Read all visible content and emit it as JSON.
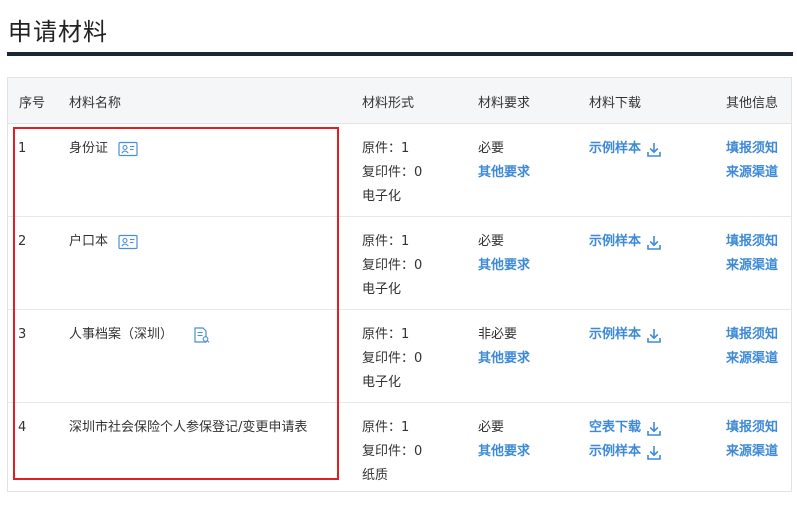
{
  "page_title": "申请材料",
  "table": {
    "headers": {
      "seq": "序号",
      "name": "材料名称",
      "form": "材料形式",
      "requirement": "材料要求",
      "download": "材料下载",
      "other": "其他信息"
    },
    "rows": [
      {
        "seq": "1",
        "name": "身份证",
        "name_icon": "id-card-icon",
        "form": [
          "原件：1",
          "复印件：0",
          "电子化"
        ],
        "requirement": "必要",
        "requirement_link": "其他要求",
        "downloads": [
          "示例样本"
        ],
        "other": [
          "填报须知",
          "来源渠道"
        ]
      },
      {
        "seq": "2",
        "name": "户口本",
        "name_icon": "id-card-icon",
        "form": [
          "原件：1",
          "复印件：0",
          "电子化"
        ],
        "requirement": "必要",
        "requirement_link": "其他要求",
        "downloads": [
          "示例样本"
        ],
        "other": [
          "填报须知",
          "来源渠道"
        ]
      },
      {
        "seq": "3",
        "name": "人事档案（深圳）",
        "name_icon": "document-icon",
        "form": [
          "原件：1",
          "复印件：0",
          "电子化"
        ],
        "requirement": "非必要",
        "requirement_link": "其他要求",
        "downloads": [
          "示例样本"
        ],
        "other": [
          "填报须知",
          "来源渠道"
        ]
      },
      {
        "seq": "4",
        "name": "深圳市社会保险个人参保登记/变更申请表",
        "name_icon": "",
        "form": [
          "原件：1",
          "复印件：0",
          "纸质"
        ],
        "requirement": "必要",
        "requirement_link": "其他要求",
        "downloads": [
          "空表下载",
          "示例样本"
        ],
        "other": [
          "填报须知",
          "来源渠道"
        ]
      }
    ]
  },
  "colors": {
    "link": "#3e8ad8",
    "header_bg": "#f5f6f8",
    "title_rule": "#1c2733",
    "highlight": "#e02020"
  }
}
